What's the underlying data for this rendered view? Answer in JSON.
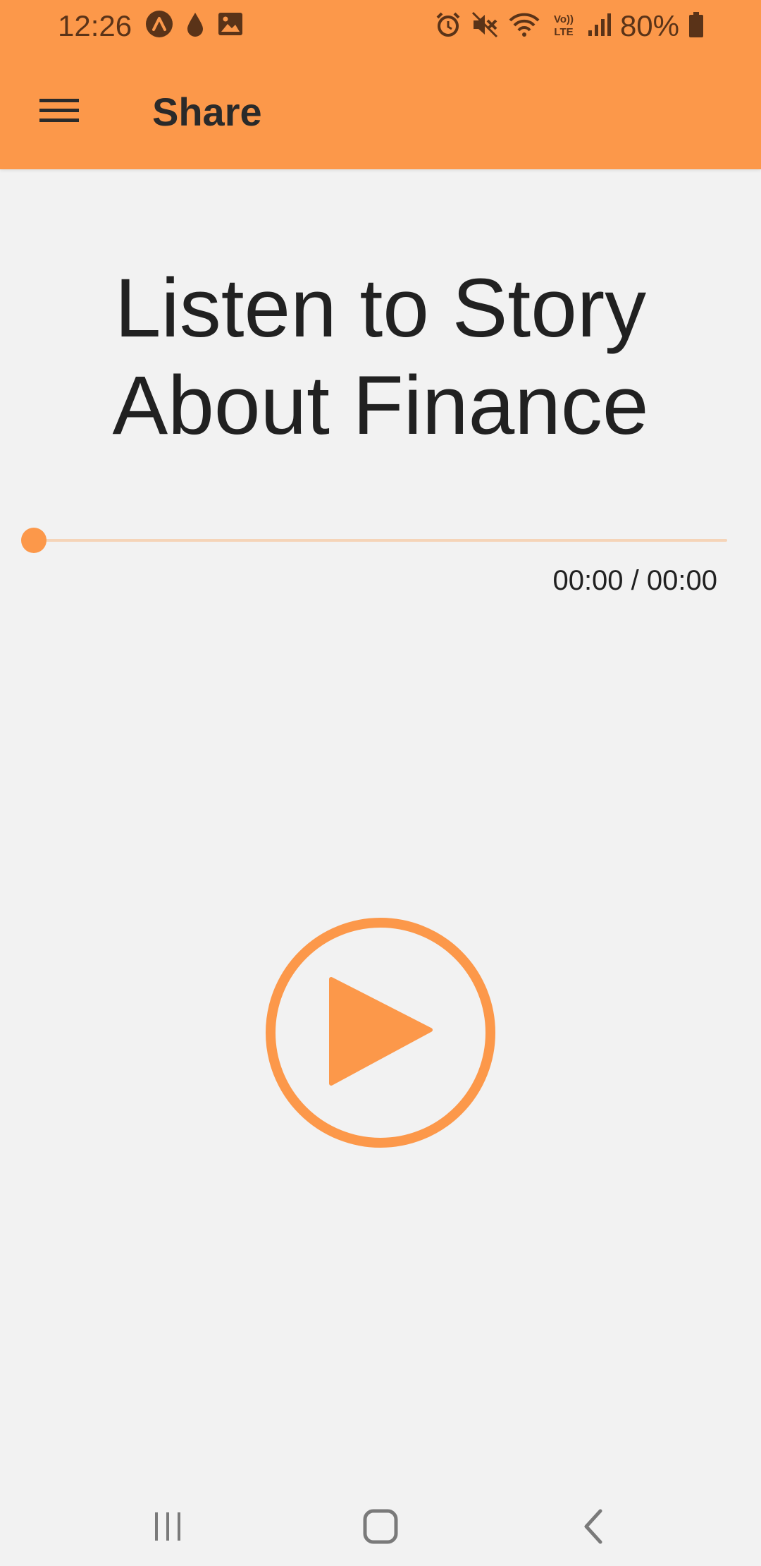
{
  "status_bar": {
    "time": "12:26",
    "battery": "80%",
    "left_icons": [
      "arch-app-icon",
      "water-drop-icon",
      "image-icon"
    ],
    "right_icons": [
      "alarm-icon",
      "mute-icon",
      "wifi-icon",
      "volte-icon",
      "signal-icon",
      "battery-icon"
    ]
  },
  "toolbar": {
    "title": "Share",
    "menu_icon": "hamburger-menu-icon"
  },
  "story": {
    "title_line1": "Listen to Story",
    "title_line2": "About Finance"
  },
  "player": {
    "progress": 0,
    "time_readout": "00:00 / 00:00",
    "play_icon": "play-circle-icon"
  },
  "nav_bar": {
    "buttons": [
      "recents-icon",
      "home-icon",
      "back-icon"
    ]
  },
  "colors": {
    "accent": "#fc984a",
    "background": "#f2f2f2",
    "text": "#212121"
  }
}
